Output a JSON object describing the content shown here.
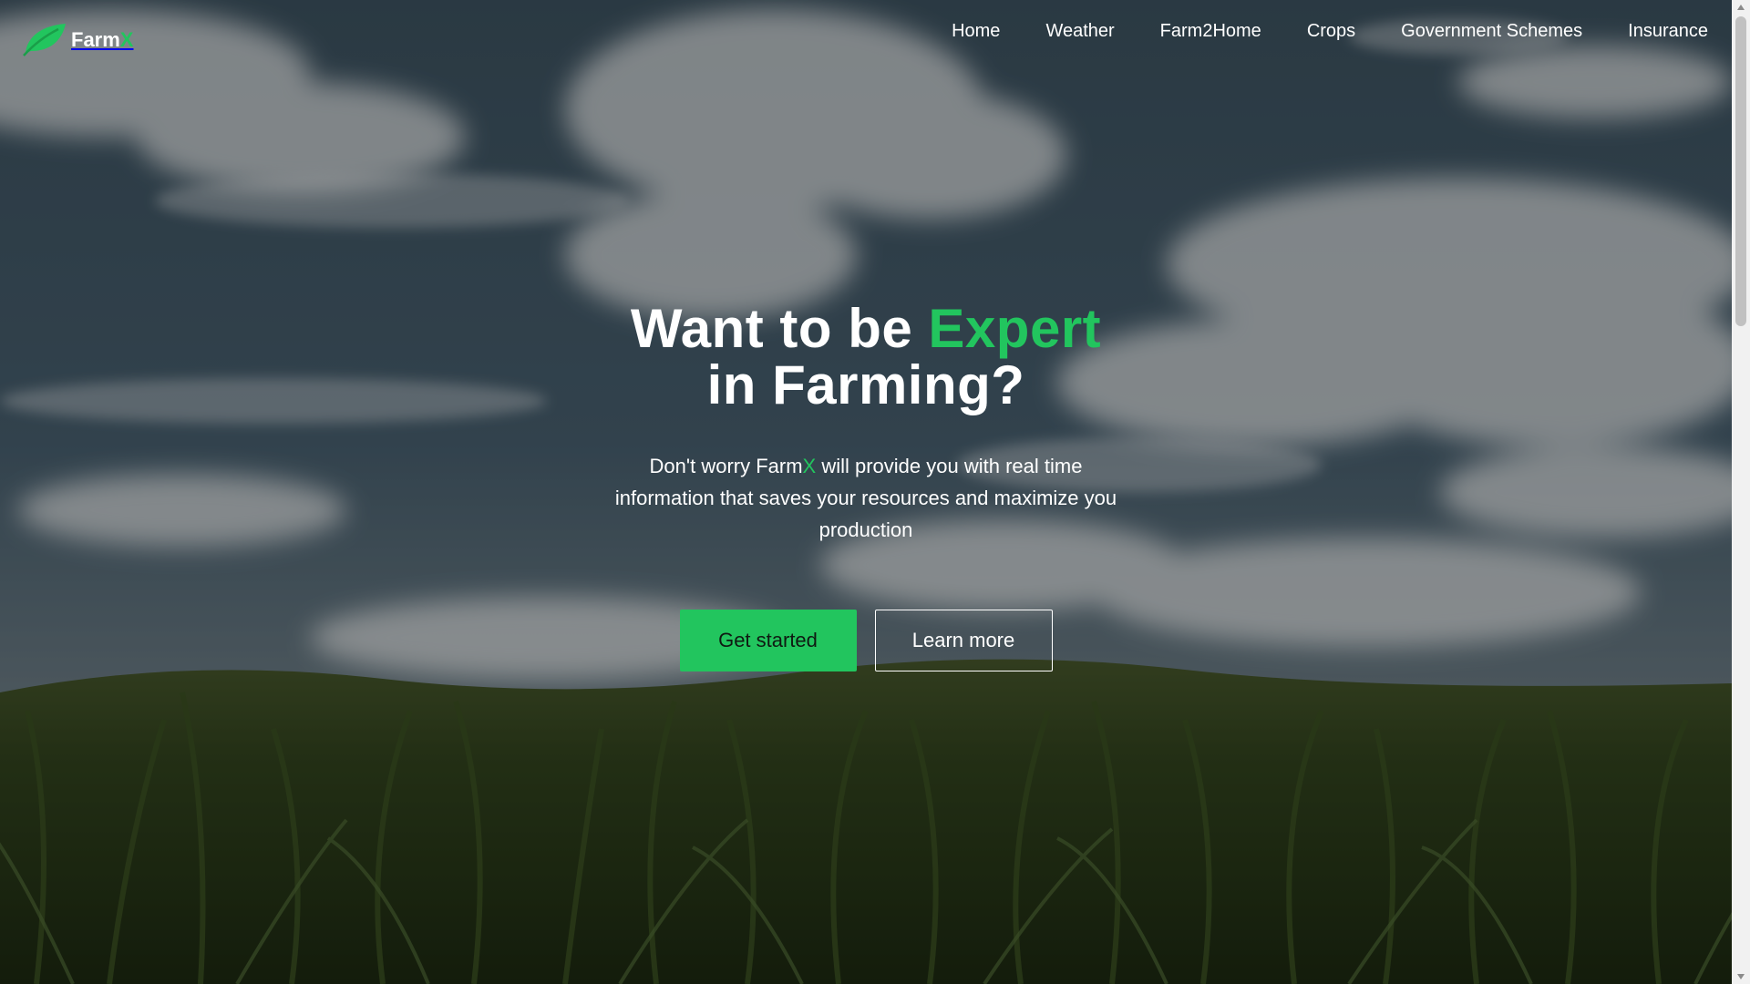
{
  "brand": {
    "name_main": "Farm",
    "name_accent": "X",
    "logo_icon": "leaf-icon"
  },
  "nav": {
    "items": [
      {
        "label": "Home"
      },
      {
        "label": "Weather"
      },
      {
        "label": "Farm2Home"
      },
      {
        "label": "Crops"
      },
      {
        "label": "Government Schemes"
      },
      {
        "label": "Insurance"
      }
    ]
  },
  "hero": {
    "title_part1": "Want to be ",
    "title_accent": "Expert",
    "title_part2": "in Farming?",
    "subtitle_part1": "Don't worry Farm",
    "subtitle_accent": "X",
    "subtitle_part2": " will provide you with real time information that saves your resources and maximize you production",
    "primary_button": "Get started",
    "secondary_button": "Learn more"
  },
  "colors": {
    "accent": "#22c55e",
    "text": "#ffffff",
    "sky": "#2f4a5c",
    "field": "#2c3a1c"
  }
}
